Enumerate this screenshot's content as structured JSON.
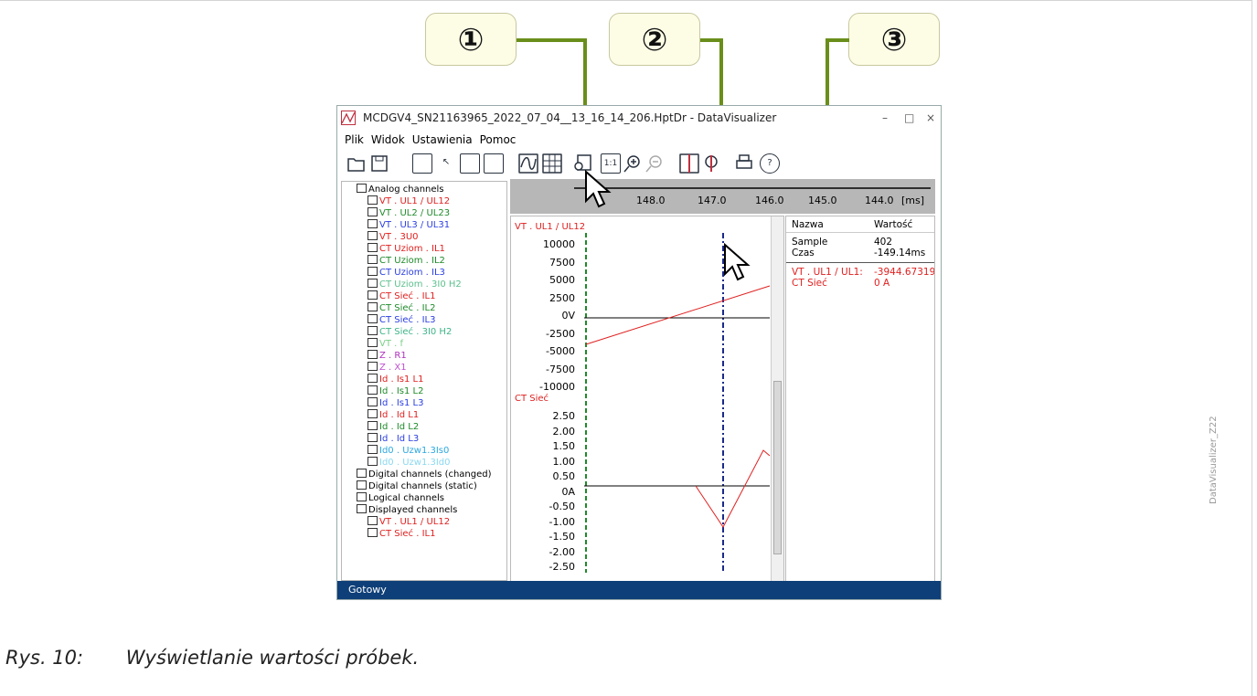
{
  "callouts": {
    "c1": "①",
    "c2": "②",
    "c3": "③"
  },
  "window": {
    "title": "MCDGV4_SN21163965_2022_07_04__13_16_14_206.HptDr - DataVisualizer",
    "min": "–",
    "max": "□",
    "close": "×"
  },
  "menu": [
    "Plik",
    "Widok",
    "Ustawienia",
    "Pomoc"
  ],
  "toolbar": {
    "zoom11": "1:1",
    "help": "?"
  },
  "tree": {
    "analog_header": "Analog channels",
    "analog": [
      {
        "label": "VT . UL1  / UL12",
        "color": "#e02020"
      },
      {
        "label": "VT . UL2  / UL23",
        "color": "#1f8a2a"
      },
      {
        "label": "VT . UL3  / UL31",
        "color": "#2a3ee0"
      },
      {
        "label": "VT . 3U0",
        "color": "#e02020"
      },
      {
        "label": "CT Uziom . IL1",
        "color": "#e02020"
      },
      {
        "label": "CT Uziom . IL2",
        "color": "#1f8a2a"
      },
      {
        "label": "CT Uziom . IL3",
        "color": "#2a3ee0"
      },
      {
        "label": "CT Uziom . 3I0 H2",
        "color": "#5cc08c"
      },
      {
        "label": "CT Sieć . IL1",
        "color": "#e02020"
      },
      {
        "label": "CT Sieć . IL2",
        "color": "#1f8a2a"
      },
      {
        "label": "CT Sieć . IL3",
        "color": "#2a3ee0"
      },
      {
        "label": "CT Sieć . 3I0 H2",
        "color": "#3eb488"
      },
      {
        "label": "VT . f",
        "color": "#7dd08a"
      },
      {
        "label": "Z . R1",
        "color": "#b030c0"
      },
      {
        "label": "Z . X1",
        "color": "#c050d0"
      },
      {
        "label": "Id . Is1 L1",
        "color": "#e02020"
      },
      {
        "label": "Id . Is1 L2",
        "color": "#1f8a2a"
      },
      {
        "label": "Id . Is1 L3",
        "color": "#2a3ee0"
      },
      {
        "label": "Id . Id L1",
        "color": "#e02020"
      },
      {
        "label": "Id . Id L2",
        "color": "#1f8a2a"
      },
      {
        "label": "Id . Id L3",
        "color": "#2a3ee0"
      },
      {
        "label": "Id0 . Uzw1.3Is0",
        "color": "#2ba8e0"
      },
      {
        "label": "Id0 . Uzw1.3Id0",
        "color": "#8ad8f0"
      }
    ],
    "groups": [
      "Digital channels (changed)",
      "Digital channels (static)",
      "Logical channels"
    ],
    "displayed_header": "Displayed channels",
    "displayed": [
      {
        "label": "VT . UL1  / UL12",
        "color": "#e02020"
      },
      {
        "label": "CT Sieć . IL1",
        "color": "#e02020"
      }
    ]
  },
  "ruler": {
    "ticks": [
      "148.0",
      "147.0",
      "146.0",
      "145.0",
      "144.0"
    ],
    "unit": "[ms]"
  },
  "plot": {
    "ch1_label": "VT . UL1  / UL12",
    "ch1_ticks": [
      "10000",
      "7500",
      "5000",
      "2500",
      "0V",
      "-2500",
      "-5000",
      "-7500",
      "-10000"
    ],
    "ch2_label": "CT Sieć",
    "ch2_ticks": [
      "2.50",
      "2.00",
      "1.50",
      "1.00",
      "0.50",
      "0A",
      "-0.50",
      "-1.00",
      "-1.50",
      "-2.00",
      "-2.50"
    ]
  },
  "values": {
    "col_name": "Nazwa",
    "col_value": "Wartość",
    "sample_label": "Sample",
    "sample_value": "402",
    "time_label": "Czas",
    "time_value": "-149.14ms",
    "ch1_name": "VT . UL1  / UL1:",
    "ch1_value": "-3944.67319",
    "ch2_name": "CT Sieć",
    "ch2_value": "0 A"
  },
  "status": "Gotowy",
  "caption": {
    "num": "Rys. 10:",
    "text": "Wyświetlanie wartości próbek."
  },
  "side_label": "DataVisualizer_Z22"
}
